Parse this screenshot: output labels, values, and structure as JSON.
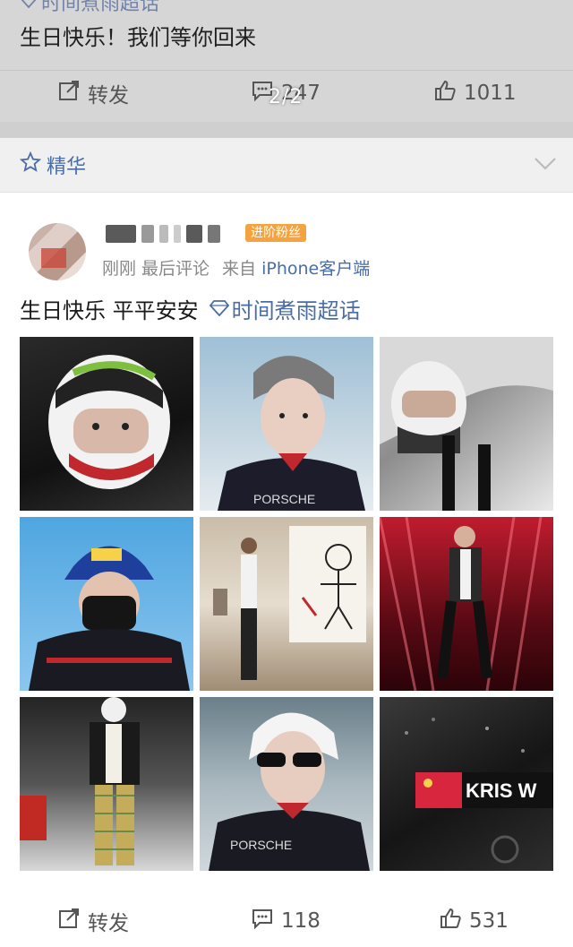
{
  "previous_post": {
    "topic": "时间煮雨超话",
    "text": "生日快乐！我们等你回来",
    "repost_label": "转发",
    "comment_count": "247",
    "like_count": "1011"
  },
  "page_indicator": "2/2",
  "section": {
    "title": "精华"
  },
  "post": {
    "fan_badge": "进阶粉丝",
    "time": "刚刚 最后评论",
    "source_prefix": "来自",
    "device": "iPhone客户端",
    "text_main": "生日快乐 平平安安",
    "topic": "时间煮雨超话",
    "photos": [
      {
        "desc": "helmet-closeup"
      },
      {
        "desc": "racing-suit-portrait"
      },
      {
        "desc": "in-car-helmet"
      },
      {
        "desc": "michelin-cap-mask"
      },
      {
        "desc": "studio-drawing"
      },
      {
        "desc": "stage-red-lights"
      },
      {
        "desc": "street-plaid-pants"
      },
      {
        "desc": "sunglasses-porsche-suit"
      },
      {
        "desc": "car-kris-w"
      }
    ],
    "car_text": "KRIS W",
    "suit_text": "PORSCHE",
    "repost_label": "转发",
    "comment_count": "118",
    "like_count": "531"
  },
  "colors": {
    "link": "#4a6da6",
    "badge": "#f4a340"
  }
}
